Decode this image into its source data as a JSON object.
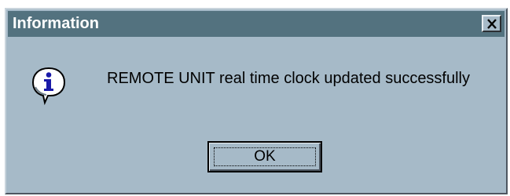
{
  "dialog": {
    "title": "Information",
    "message": "REMOTE UNIT real time clock updated successfully",
    "ok_label": "OK",
    "icon": "info-icon",
    "close_icon": "close-icon"
  },
  "colors": {
    "title_bar": "#53727f",
    "window_bg": "#a6bac8",
    "title_text": "#ffffff",
    "info_blue": "#1a1aa8"
  }
}
